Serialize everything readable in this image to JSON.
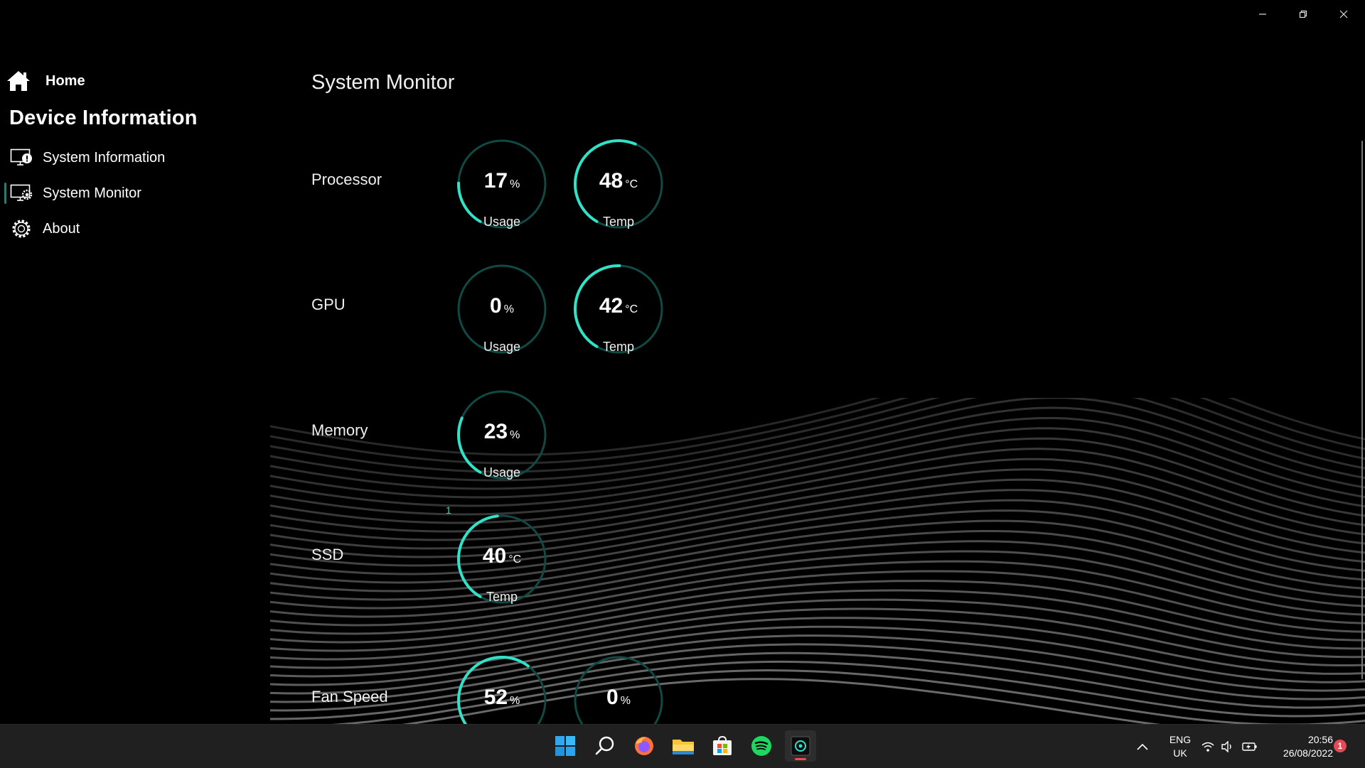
{
  "window": {
    "minimize_icon": "minimize-icon",
    "restore_icon": "restore-icon",
    "close_icon": "close-icon"
  },
  "sidebar": {
    "home_label": "Home",
    "section_title": "Device Information",
    "items": [
      {
        "label": "System Information",
        "icon": "monitor-info-icon"
      },
      {
        "label": "System Monitor",
        "icon": "monitor-gear-icon",
        "selected": true
      },
      {
        "label": "About",
        "icon": "gear-icon"
      }
    ]
  },
  "main": {
    "title": "System Monitor",
    "rows": [
      {
        "label": "Processor",
        "gauges": [
          {
            "value": "17",
            "unit": "%",
            "caption": "Usage",
            "fraction": 0.17
          },
          {
            "value": "48",
            "unit": "°C",
            "caption": "Temp",
            "fraction": 0.48
          }
        ]
      },
      {
        "label": "GPU",
        "gauges": [
          {
            "value": "0",
            "unit": "%",
            "caption": "Usage",
            "fraction": 0.0
          },
          {
            "value": "42",
            "unit": "°C",
            "caption": "Temp",
            "fraction": 0.42
          }
        ]
      },
      {
        "label": "Memory",
        "gauges": [
          {
            "value": "23",
            "unit": "%",
            "caption": "Usage",
            "fraction": 0.23
          }
        ]
      },
      {
        "label": "SSD",
        "small_label": "1",
        "gauges": [
          {
            "value": "40",
            "unit": "°C",
            "caption": "Temp",
            "fraction": 0.4
          }
        ]
      },
      {
        "label": "Fan Speed",
        "gauges": [
          {
            "value": "52",
            "unit": "%",
            "caption": "",
            "fraction": 0.52
          },
          {
            "value": "0",
            "unit": "%",
            "caption": "",
            "fraction": 0.0
          }
        ]
      }
    ]
  },
  "colors": {
    "accent": "#2fe2c8",
    "track": "#0f4a45",
    "background": "#000000",
    "taskbar": "#202020"
  },
  "taskbar": {
    "apps": [
      "windows-start-icon",
      "search-icon",
      "firefox-icon",
      "file-explorer-icon",
      "microsoft-store-icon",
      "spotify-icon",
      "system-monitor-app-icon"
    ],
    "language": {
      "line1": "ENG",
      "line2": "UK"
    },
    "clock": {
      "time": "20:56",
      "date": "26/08/2022"
    },
    "notification_count": "1"
  }
}
